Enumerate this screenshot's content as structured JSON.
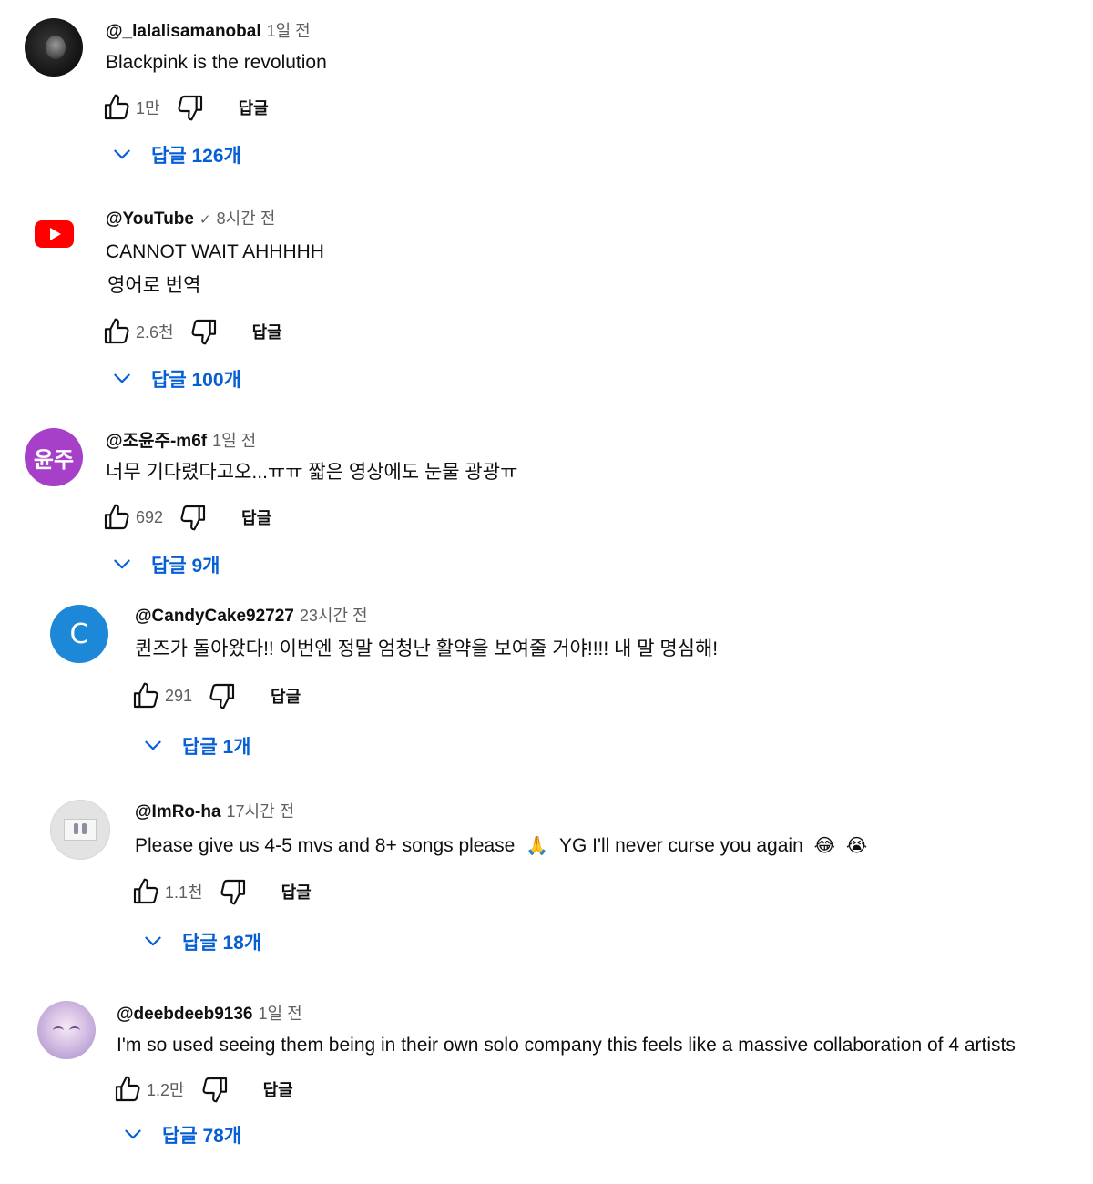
{
  "comments": [
    {
      "username": "@_lalalisamanobal",
      "timestamp": "1일 전",
      "text": "Blackpink is the revolution",
      "likes": "1만",
      "reply_label": "답글",
      "replies_label": "답글 126개"
    },
    {
      "username": "@YouTube",
      "verified": "✓",
      "timestamp": "8시간 전",
      "text": "CANNOT WAIT AHHHHH",
      "translate_label": "영어로 번역",
      "likes": "2.6천",
      "reply_label": "답글",
      "replies_label": "답글 100개"
    },
    {
      "username": "@조윤주-m6f",
      "avatar_text": "윤주",
      "timestamp": "1일 전",
      "text": "너무 기다렸다고오...ㅠㅠ 짧은 영상에도 눈물 광광ㅠ",
      "likes": "692",
      "reply_label": "답글",
      "replies_label": "답글 9개"
    },
    {
      "username": "@CandyCake92727",
      "avatar_text": "C",
      "timestamp": "23시간 전",
      "text": "퀸즈가 돌아왔다!! 이번엔 정말 엄청난 활약을 보여줄 거야!!!! 내 말 명심해!",
      "likes": "291",
      "reply_label": "답글",
      "replies_label": "답글 1개"
    },
    {
      "username": "@ImRo-ha",
      "timestamp": "17시간 전",
      "text_before": "Please give us 4-5 mvs and 8+ songs please",
      "emoji_1": "🙏",
      "text_middle": "YG I'll never curse you again",
      "emoji_2": "😂",
      "emoji_3": "😭",
      "likes": "1.1천",
      "reply_label": "답글",
      "replies_label": "답글 18개"
    },
    {
      "username": "@deebdeeb9136",
      "timestamp": "1일 전",
      "text": "I'm so used seeing them being in their own solo company this feels like a massive collaboration of 4 artists",
      "likes": "1.2만",
      "reply_label": "답글",
      "replies_label": "답글 78개"
    }
  ],
  "colors": {
    "link_blue": "#065fd4",
    "text_primary": "#0f0f0f",
    "text_secondary": "#606060",
    "youtube_red": "#ff0000",
    "avatar_purple": "#a640c9",
    "avatar_blue": "#1e88d8"
  }
}
